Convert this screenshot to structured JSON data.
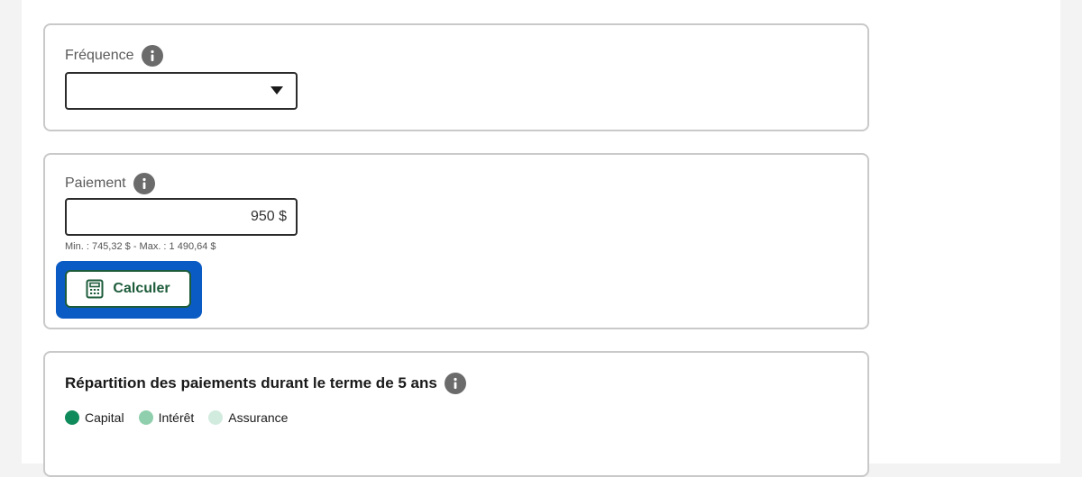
{
  "frequency": {
    "label": "Fréquence",
    "selected_value": ""
  },
  "payment": {
    "label": "Paiement",
    "value": "950 $",
    "hint": "Min. : 745,32 $ - Max. : 1 490,64 $",
    "calculate_label": "Calculer"
  },
  "breakdown": {
    "title": "Répartition des paiements durant le terme de 5 ans",
    "legend": [
      {
        "label": "Capital",
        "color": "#0f8a5a"
      },
      {
        "label": "Intérêt",
        "color": "#8fcfad"
      },
      {
        "label": "Assurance",
        "color": "#d2ebdf"
      }
    ]
  },
  "colors": {
    "primary_green": "#1d5c3b",
    "focus_blue": "#0a5bc4",
    "info_icon": "#6b6b6b"
  }
}
